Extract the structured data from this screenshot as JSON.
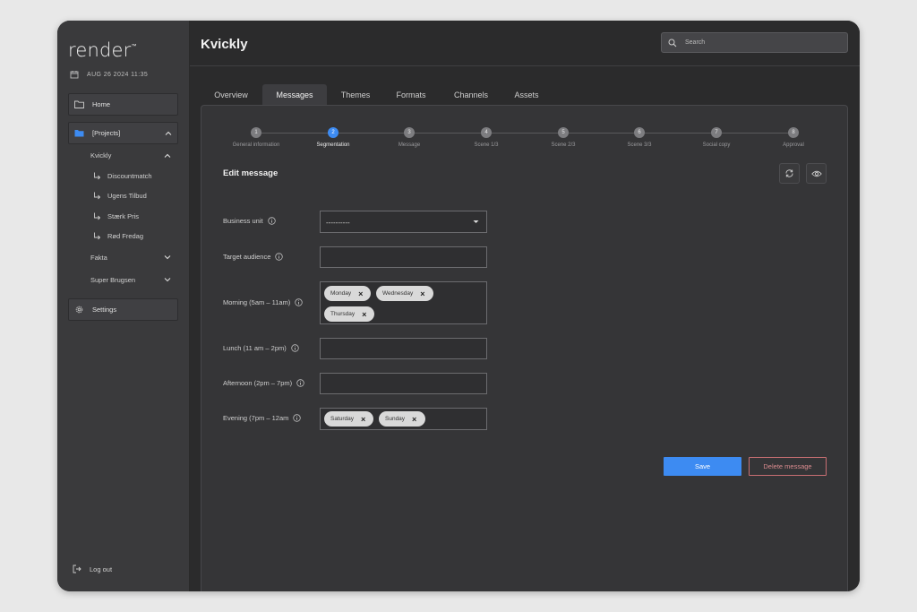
{
  "app": {
    "logo": "render",
    "logo_mark": "™",
    "datetime": "AUG 26 2024 11:35"
  },
  "sidebar": {
    "home": "Home",
    "projects": "[Projects]",
    "clients": [
      {
        "label": "Kvickly",
        "children": [
          "Discountmatch",
          "Ugens Tilbud",
          "Stærk Pris",
          "Rød Fredag"
        ]
      },
      {
        "label": "Fakta"
      },
      {
        "label": "Super Brugsen"
      }
    ],
    "settings": "Settings",
    "logout": "Log out"
  },
  "header": {
    "title": "Kvickly",
    "search_placeholder": "Search"
  },
  "tabs": [
    "Overview",
    "Messages",
    "Themes",
    "Formats",
    "Channels",
    "Assets"
  ],
  "active_tab": "Messages",
  "steps": [
    {
      "num": "1",
      "label": "General information"
    },
    {
      "num": "2",
      "label": "Segmentation"
    },
    {
      "num": "3",
      "label": "Message"
    },
    {
      "num": "4",
      "label": "Scene 1/3"
    },
    {
      "num": "5",
      "label": "Scene 2/3"
    },
    {
      "num": "6",
      "label": "Scene 3/3"
    },
    {
      "num": "7",
      "label": "Social copy"
    },
    {
      "num": "8",
      "label": "Approval"
    }
  ],
  "active_step": "2",
  "form": {
    "title": "Edit message",
    "business_unit": {
      "label": "Business unit",
      "value": "----------"
    },
    "target_audience": {
      "label": "Target audience",
      "value": ""
    },
    "morning": {
      "label": "Morning (5am – 11am)",
      "chips": [
        "Monday",
        "Wednesday",
        "Thursday"
      ]
    },
    "lunch": {
      "label": "Lunch (11 am – 2pm)",
      "chips": []
    },
    "afternoon": {
      "label": "Afternoon (2pm – 7pm)",
      "chips": []
    },
    "evening": {
      "label": "Evening (7pm – 12am",
      "chips": [
        "Saturday",
        "Sunday"
      ]
    }
  },
  "actions": {
    "save": "Save",
    "delete": "Delete message"
  },
  "colors": {
    "accent": "#3d8bf2",
    "danger": "#c86f73"
  }
}
